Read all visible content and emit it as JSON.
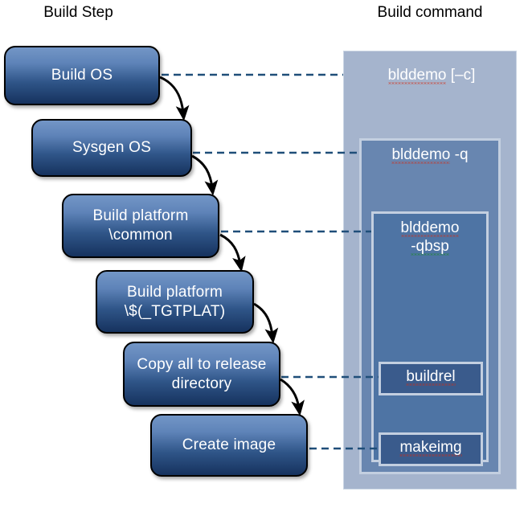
{
  "headers": {
    "left": "Build Step",
    "right": "Build command"
  },
  "steps": [
    {
      "id": "build-os",
      "label": "Build OS"
    },
    {
      "id": "sysgen-os",
      "label": "Sysgen OS"
    },
    {
      "id": "build-platform-common",
      "label": "Build platform\n\\common"
    },
    {
      "id": "build-platform-tgtplat",
      "label": "Build platform\n\\$(_TGTPLAT)"
    },
    {
      "id": "copy-all-to-release",
      "label": "Copy all to\nrelease directory"
    },
    {
      "id": "create-image",
      "label": "Create image"
    }
  ],
  "commands": [
    {
      "id": "blddemo-c",
      "label": "blddemo [–c]",
      "level": 1
    },
    {
      "id": "blddemo-q",
      "label": "blddemo -q",
      "level": 2
    },
    {
      "id": "blddemo-qbsp",
      "label": "blddemo\n-qbsp",
      "level": 3
    },
    {
      "id": "buildrel",
      "label": "buildrel",
      "level": 4
    },
    {
      "id": "makeimg",
      "label": "makeimg",
      "level": 4
    }
  ],
  "colors": {
    "panel_outer": "#A5B4CD",
    "panel_level2": "#6886B0",
    "panel_level3": "#4E74A4",
    "leaf_box": "#3A5B8C",
    "panel_border": "#C3CFE0",
    "step_gradient_top": "#7396C6",
    "step_gradient_bottom": "#16325E",
    "connector": "#1F4E79",
    "arrow": "#000000",
    "text": "#FFFFFF",
    "header_text": "#000000"
  }
}
